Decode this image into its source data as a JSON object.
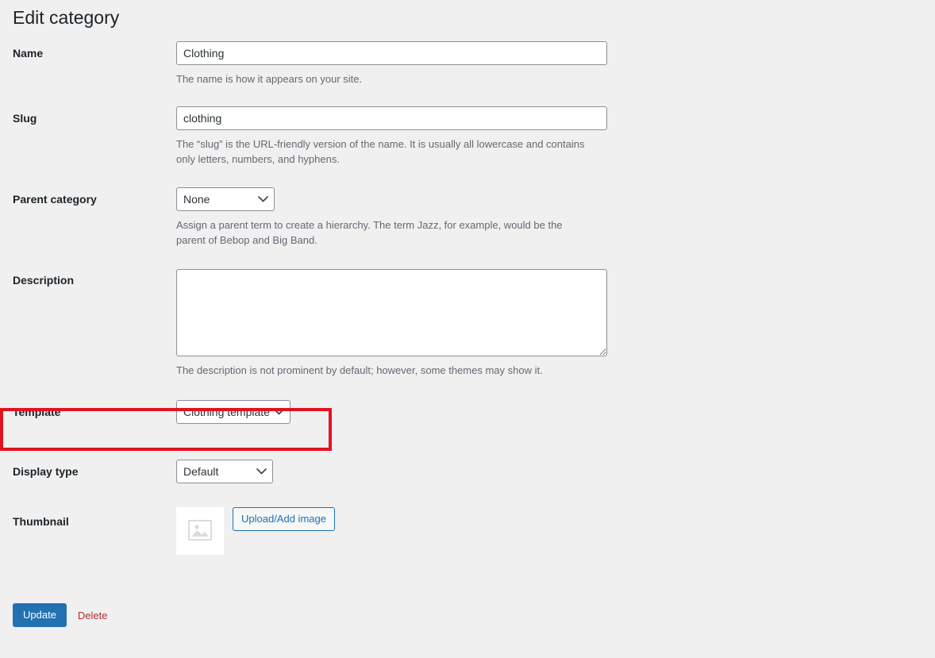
{
  "page": {
    "title": "Edit category"
  },
  "fields": {
    "name": {
      "label": "Name",
      "value": "Clothing",
      "placeholder": "",
      "help": "The name is how it appears on your site."
    },
    "slug": {
      "label": "Slug",
      "value": "clothing",
      "placeholder": "",
      "help": "The “slug” is the URL-friendly version of the name. It is usually all lowercase and contains only letters, numbers, and hyphens."
    },
    "parent": {
      "label": "Parent category",
      "value": "None",
      "options": [
        "None"
      ],
      "help": "Assign a parent term to create a hierarchy. The term Jazz, for example, would be the parent of Bebop and Big Band."
    },
    "description": {
      "label": "Description",
      "value": "",
      "placeholder": "",
      "help": "The description is not prominent by default; however, some themes may show it."
    },
    "template": {
      "label": "Template",
      "value": "Clothing template",
      "options": [
        "Clothing template"
      ],
      "highlighted": true,
      "highlight_color": "#e3121f"
    },
    "display_type": {
      "label": "Display type",
      "value": "Default",
      "options": [
        "Default"
      ]
    },
    "thumbnail": {
      "label": "Thumbnail",
      "placeholder_icon": "image-placeholder-icon",
      "upload_button_label": "Upload/Add image"
    }
  },
  "actions": {
    "update_label": "Update",
    "delete_label": "Delete"
  },
  "colors": {
    "page_background": "#f0f0f1",
    "primary_button": "#2271b1",
    "delete_link": "#b32d2e",
    "highlight_border": "#e3121f",
    "help_text": "#646970",
    "input_border": "#8c8f94"
  },
  "icons": {
    "chevron_down": "chevron-down-icon",
    "image_placeholder": "image-placeholder-icon"
  }
}
